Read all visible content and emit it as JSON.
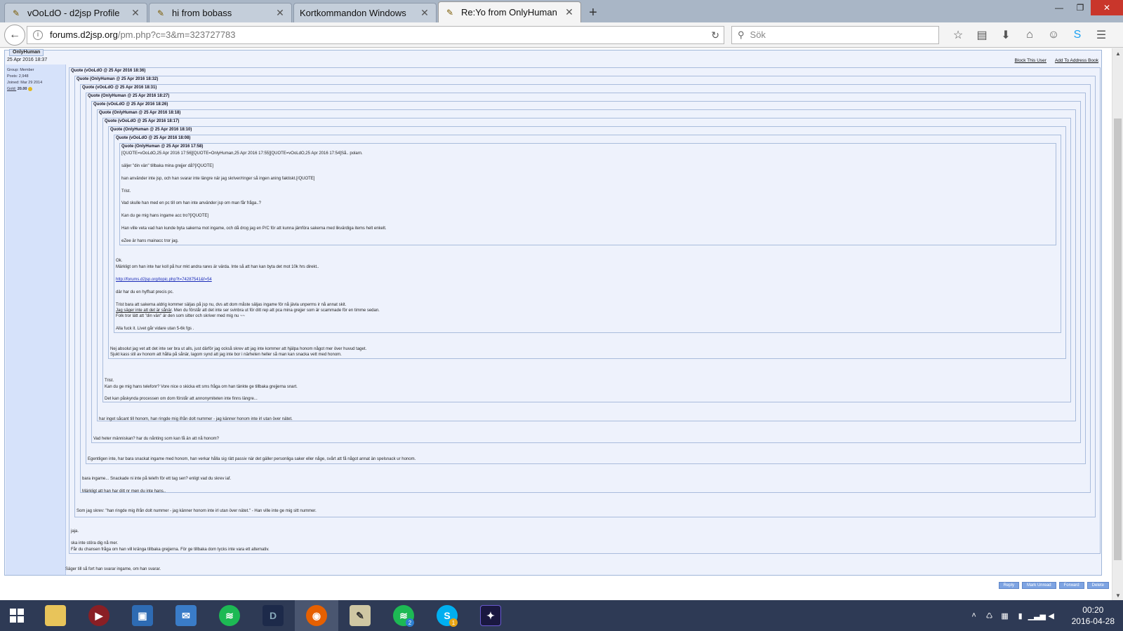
{
  "browser": {
    "tabs": [
      {
        "title": "vOoLdO - d2jsp Profile",
        "active": false
      },
      {
        "title": "hi from bobass",
        "active": false
      },
      {
        "title": "Kortkommandon Windows",
        "active": false
      },
      {
        "title": "Re:Yo from OnlyHuman",
        "active": true
      }
    ],
    "url_host": "forums.d2jsp.org",
    "url_path": "/pm.php?c=3&m=323727783",
    "search_placeholder": "Sök"
  },
  "pm": {
    "author": "OnlyHuman",
    "date": "25 Apr 2016 18:37",
    "sidebar": {
      "group": "Group: Member",
      "posts": "Posts: 2,948",
      "joined": "Joined: Mar 29 2014",
      "gold_label": "Gold:",
      "gold_value": "20.00"
    },
    "top_links": {
      "block": "Block This User",
      "address": "Add To Address Book"
    },
    "quotes": [
      "Quote (vOoLdO @ 25 Apr 2016 18:36)",
      "Quote (OnlyHuman @ 25 Apr 2016 18:32)",
      "Quote (vOoLdO @ 25 Apr 2016 18:31)",
      "Quote (OnlyHuman @ 25 Apr 2016 18:27)",
      "Quote (vOoLdO @ 25 Apr 2016 18:26)",
      "Quote (OnlyHuman @ 25 Apr 2016 18:18)",
      "Quote (vOoLdO @ 25 Apr 2016 18:17)",
      "Quote (OnlyHuman @ 25 Apr 2016 18:10)",
      "Quote (vOoLdO @ 25 Apr 2016 18:08)",
      "Quote (OnlyHuman @ 25 Apr 2016 17:58)"
    ],
    "innermost": [
      "[QUOTE=vOoLdO,25 Apr 2016 17:56][QUOTE=OnlyHuman,25 Apr 2016 17:55][QUOTE=vOoLdO,25 Apr 2016 17:54]Så.. polarn.",
      "säljer \"din vän\" tillbaka mina grejjer då?[/QUOTE]",
      "han använder inte jsp, och han svarar inte längre när jag skriver/ringer så ingen aning faktiskt.[/QUOTE]",
      "Trist.",
      "Vad skulle han med en pc till om han inte använder jsp om man får fråga..?",
      "Kan du ge mig hans ingame acc tro?[/QUOTE]",
      "Han ville veta vad han kunde byta sakerna mot ingame, och då drog jag en P/C för att kunna jämföra sakerna med likvärdiga items helt enkelt.",
      "eZee är hans mainacc tror jag."
    ],
    "level9": {
      "ok": "Ok.",
      "line1": "Märkligt om han inte har koll på hur mkt andra rares är värda. Inte så att han kan byta det mot 10k hrs direkt..",
      "link": "http://forums.d2jsp.org/topic.php?t=74287541&f=54",
      "line2": "där har du en hyffsat precis pc.",
      "line3": "Trist bara att sakerna aldrig kommer säljas på jsp nu, dvs att dom måste säljas ingame för nå jävla unperms ir nå annat skit.",
      "line4a": "Jag säger inte att det är sånär",
      "line4b": ". Men du förstår att det inte ser svinbra ut för ditt rep att pca mina grejjer som är scammade för en timme sedan.",
      "line5": "Folk tror lätt att \"din vän\" är den som sitter och skriver med mig nu ~~",
      "line6": "Alla fuck it. Livet går vidare utan 5-6k fgs ."
    },
    "level8": [
      "Nej absolut jag vet att det inte ser bra ut alls, just därför jag också skrev att jag inte kommer att hjälpa honom något mer över huvud taget.",
      "Sjukt kass stil av honom att hålla på sånär, lagom synd att jag inte bor i närheten heller så man kan snacka vett med honom."
    ],
    "level7": [
      "Trist.",
      "Kan du ge mig hans telefonr? Vore nice o skicka ett sms fråga om han tänkte ge tillbaka grejjerna snart.",
      "Det kan påskynda processen om dom förstår att annonymiteten inte finns längre..."
    ],
    "level6": "har inget såcant till honom, han ringde mig ifrån dolt nummer - jag känner honom inte irl utan över nätet.",
    "level5": "Vad heter människan? har du nånting som kan få än att nå honom?",
    "level4": "Egentligen inte, har bara snackat ingame med honom, han verkar hålla sig rätt passiv när det gäller personliga saker eller någe, svårt att få något annat än spelsnack ur honom.",
    "level3": [
      "bara ingame... Snackade ni inte på telefn för ett tag sen? enligt vad du skrev iaf.",
      "Märkligt att han har ditt nr men du inte hans.."
    ],
    "level2": "Som jag skrev: \"han ringde mig ifrån dolt nummer - jag känner honom inte irl utan över nätet.\" - Han ville inte ge mig sitt nummer.",
    "level1": [
      "jaja.",
      "ska inte störa dig nå mer.",
      "Får du chansen fråga om han vill kränga tillbaka grejjerna. För ge tillbaka dom tycks inte vara ett alternativ."
    ],
    "reply_text": "Säger till så fort han svarar ingame, om han svarar.",
    "buttons": {
      "reply": "Reply",
      "unread": "Mark Unread",
      "forward": "Forward",
      "delete": "Delete"
    }
  },
  "taskbar": {
    "badges": {
      "spotify": "2",
      "skype": "1"
    },
    "time": "00:20",
    "date": "2016-04-28"
  }
}
